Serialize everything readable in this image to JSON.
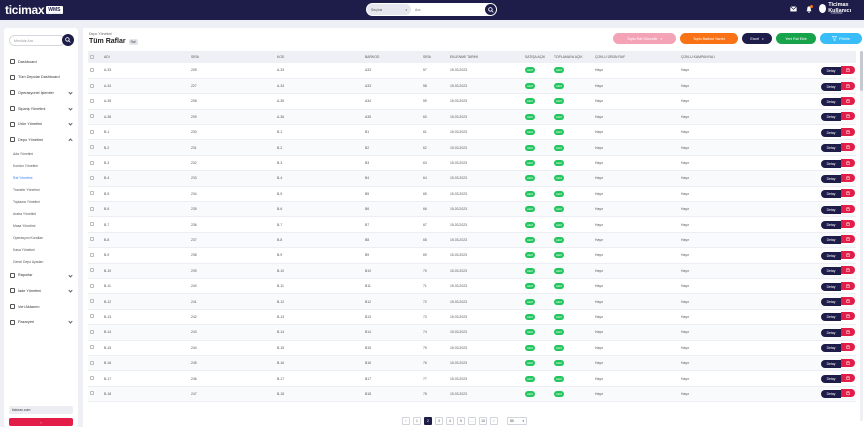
{
  "brand": {
    "name": "ticimax",
    "badge": "WMS",
    "sub": "by ticimax"
  },
  "search": {
    "select_value": "Seçiniz",
    "placeholder": "Ara"
  },
  "user": {
    "name": "Ticimax Kullanıcı",
    "role": "Yönetici"
  },
  "icons": {
    "search": "search-icon",
    "mail": "mail-icon",
    "bell": "bell-icon",
    "delete": "trash-icon",
    "filter": "filter-icon"
  },
  "sidebar": {
    "search_placeholder": "Menüde Ara",
    "items": [
      {
        "label": "Dashboard"
      },
      {
        "label": "Tüm Depolar Dashboard"
      },
      {
        "label": "Operasyonel İşlemler"
      },
      {
        "label": "Sipariş Yönetimi"
      },
      {
        "label": "Ürün Yönetimi"
      },
      {
        "label": "Depo Yönetimi"
      }
    ],
    "subitems": [
      {
        "label": "Ada Yönetimi"
      },
      {
        "label": "Koridor Yönetimi"
      },
      {
        "label": "Raf Yönetimi"
      },
      {
        "label": "Transfer Yönetimi"
      },
      {
        "label": "Toplama Yönetimi"
      },
      {
        "label": "Araba Yönetimi"
      },
      {
        "label": "Masa Yönetimi"
      },
      {
        "label": "Operasyon Kuralları"
      },
      {
        "label": "Kasa Yönetimi"
      },
      {
        "label": "Genel Depo Ayarları"
      }
    ],
    "items2": [
      {
        "label": "Raporlar"
      },
      {
        "label": "İade Yönetimi"
      },
      {
        "label": "Veri Aktarımı"
      },
      {
        "label": "Pazaryeri"
      }
    ],
    "footer": "ticimax.com"
  },
  "page": {
    "breadcrumb": "Depo Yönetimi",
    "title": "Tüm Raflar",
    "count": "Raf"
  },
  "actions": [
    {
      "label": "Toplu Raf Güncelle",
      "color": "#f4a3b6"
    },
    {
      "label": "Toplu Barkod Yazdır",
      "color": "#f97316"
    },
    {
      "label": "Excel",
      "color": "#1e1d4a"
    },
    {
      "label": "Yeni Raf Ekle",
      "color": "#16a34a"
    },
    {
      "label": "Filtrele",
      "color": "#38bdf8"
    }
  ],
  "table": {
    "headers": [
      "",
      "ADI",
      "SIRA",
      "KOD",
      "BARKOD",
      "SIRA",
      "EKLENME TARİHİ",
      "SATIŞA AÇIK",
      "TOPLAMAYA AÇIK",
      "ÇOKLU ÜRÜN RAF",
      "ÇOKLU KAMPANYALI",
      ""
    ],
    "rows": [
      [
        "A-33",
        "205",
        "A-33",
        "A33",
        "57",
        "15.03.2023",
        "Aktif",
        "Aktif",
        "Hayır",
        "Hayır"
      ],
      [
        "A-34",
        "227",
        "A-34",
        "A33",
        "58",
        "15.03.2023",
        "Aktif",
        "Aktif",
        "Hayır",
        "Hayır"
      ],
      [
        "A-35",
        "208",
        "A-35",
        "A34",
        "59",
        "15.03.2023",
        "Aktif",
        "Aktif",
        "Hayır",
        "Hayır"
      ],
      [
        "A-36",
        "209",
        "A-36",
        "A35",
        "60",
        "15.03.2023",
        "Aktif",
        "Aktif",
        "Hayır",
        "Hayır"
      ],
      [
        "B-1",
        "230",
        "B-1",
        "B1",
        "61",
        "15.03.2023",
        "Aktif",
        "Aktif",
        "Hayır",
        "Hayır"
      ],
      [
        "B-2",
        "231",
        "B-2",
        "B2",
        "62",
        "15.03.2023",
        "Aktif",
        "Aktif",
        "Hayır",
        "Hayır"
      ],
      [
        "B-3",
        "232",
        "B-3",
        "B3",
        "63",
        "15.03.2023",
        "Aktif",
        "Aktif",
        "Hayır",
        "Hayır"
      ],
      [
        "B-4",
        "233",
        "B-4",
        "B4",
        "64",
        "15.03.2023",
        "Aktif",
        "Aktif",
        "Hayır",
        "Hayır"
      ],
      [
        "B-5",
        "234",
        "B-5",
        "B5",
        "65",
        "15.03.2023",
        "Aktif",
        "Aktif",
        "Hayır",
        "Hayır"
      ],
      [
        "B-6",
        "235",
        "B-6",
        "B6",
        "66",
        "15.03.2023",
        "Aktif",
        "Aktif",
        "Hayır",
        "Hayır"
      ],
      [
        "B-7",
        "236",
        "B-7",
        "B7",
        "67",
        "15.03.2023",
        "Aktif",
        "Aktif",
        "Hayır",
        "Hayır"
      ],
      [
        "B-8",
        "237",
        "B-8",
        "B8",
        "68",
        "15.03.2023",
        "Aktif",
        "Aktif",
        "Hayır",
        "Hayır"
      ],
      [
        "B-9",
        "238",
        "B-9",
        "B9",
        "69",
        "15.03.2023",
        "Aktif",
        "Aktif",
        "Hayır",
        "Hayır"
      ],
      [
        "B-10",
        "239",
        "B-10",
        "B10",
        "70",
        "15.03.2023",
        "Aktif",
        "Aktif",
        "Hayır",
        "Hayır"
      ],
      [
        "B-11",
        "240",
        "B-11",
        "B11",
        "71",
        "15.03.2023",
        "Aktif",
        "Aktif",
        "Hayır",
        "Hayır"
      ],
      [
        "B-12",
        "241",
        "B-12",
        "B12",
        "72",
        "15.03.2023",
        "Aktif",
        "Aktif",
        "Hayır",
        "Hayır"
      ],
      [
        "B-13",
        "242",
        "B-13",
        "B13",
        "73",
        "15.03.2023",
        "Aktif",
        "Aktif",
        "Hayır",
        "Hayır"
      ],
      [
        "B-14",
        "243",
        "B-14",
        "B14",
        "74",
        "15.03.2023",
        "Aktif",
        "Aktif",
        "Hayır",
        "Hayır"
      ],
      [
        "B-15",
        "244",
        "B-15",
        "B15",
        "75",
        "15.03.2023",
        "Aktif",
        "Aktif",
        "Hayır",
        "Hayır"
      ],
      [
        "B-16",
        "245",
        "B-16",
        "B16",
        "76",
        "15.03.2023",
        "Aktif",
        "Aktif",
        "Hayır",
        "Hayır"
      ],
      [
        "B-17",
        "246",
        "B-17",
        "B17",
        "77",
        "15.03.2023",
        "Aktif",
        "Aktif",
        "Hayır",
        "Hayır"
      ],
      [
        "B-18",
        "247",
        "B-18",
        "B18",
        "78",
        "15.03.2023",
        "Aktif",
        "Aktif",
        "Hayır",
        "Hayır"
      ]
    ],
    "detail_label": "Detay"
  },
  "pagination": {
    "pages": [
      "‹",
      "1",
      "2",
      "3",
      "4",
      "5",
      "…",
      "15",
      "›"
    ],
    "active": "2",
    "page_size": "50"
  }
}
